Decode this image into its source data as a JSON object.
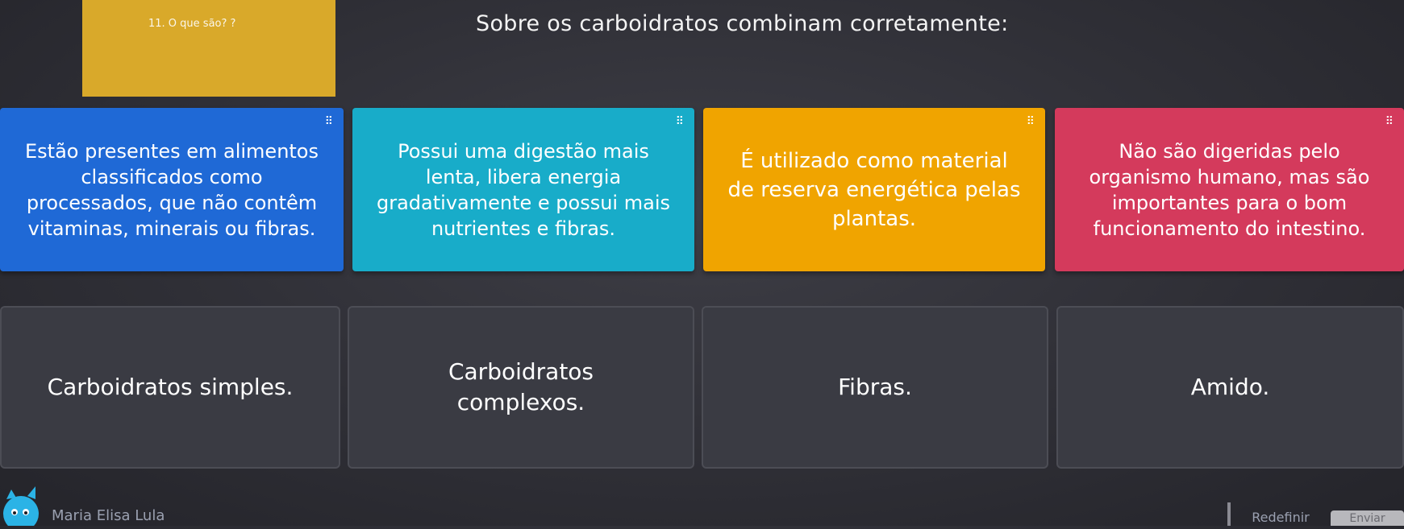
{
  "question": {
    "image_caption": "11. O que são? ?",
    "title": "Sobre os carboidratos combinam corretamente:"
  },
  "colors": {
    "card_blue": "#1f69d6",
    "card_teal": "#18acc9",
    "card_orange": "#f0a400",
    "card_red": "#d43a5c",
    "question_image_bg": "#d9a92a",
    "target_bg": "#3a3b43"
  },
  "cards": [
    {
      "text": "Estão presentes em alimentos classificados como processados, que não contêm vitaminas, minerais ou fibras.",
      "grip": "⠿"
    },
    {
      "text": "Possui uma digestão mais lenta, libera energia gradativamente e possui mais nutrientes e fibras.",
      "grip": "⠿"
    },
    {
      "text": "É utilizado como material de reserva energética pelas plantas.",
      "grip": "⠿"
    },
    {
      "text": "Não são digeridas pelo organismo humano, mas são importantes para o bom funcionamento do intestino.",
      "grip": "⠿"
    }
  ],
  "targets": [
    {
      "label": "Carboidratos simples."
    },
    {
      "label": "Carboidratos complexos."
    },
    {
      "label": "Fibras."
    },
    {
      "label": "Amido."
    }
  ],
  "footer": {
    "player_name": "Maria Elisa Lula",
    "reset_label": "Redefinir",
    "submit_label": "Enviar",
    "avatar_icon": "avatar-icon"
  }
}
